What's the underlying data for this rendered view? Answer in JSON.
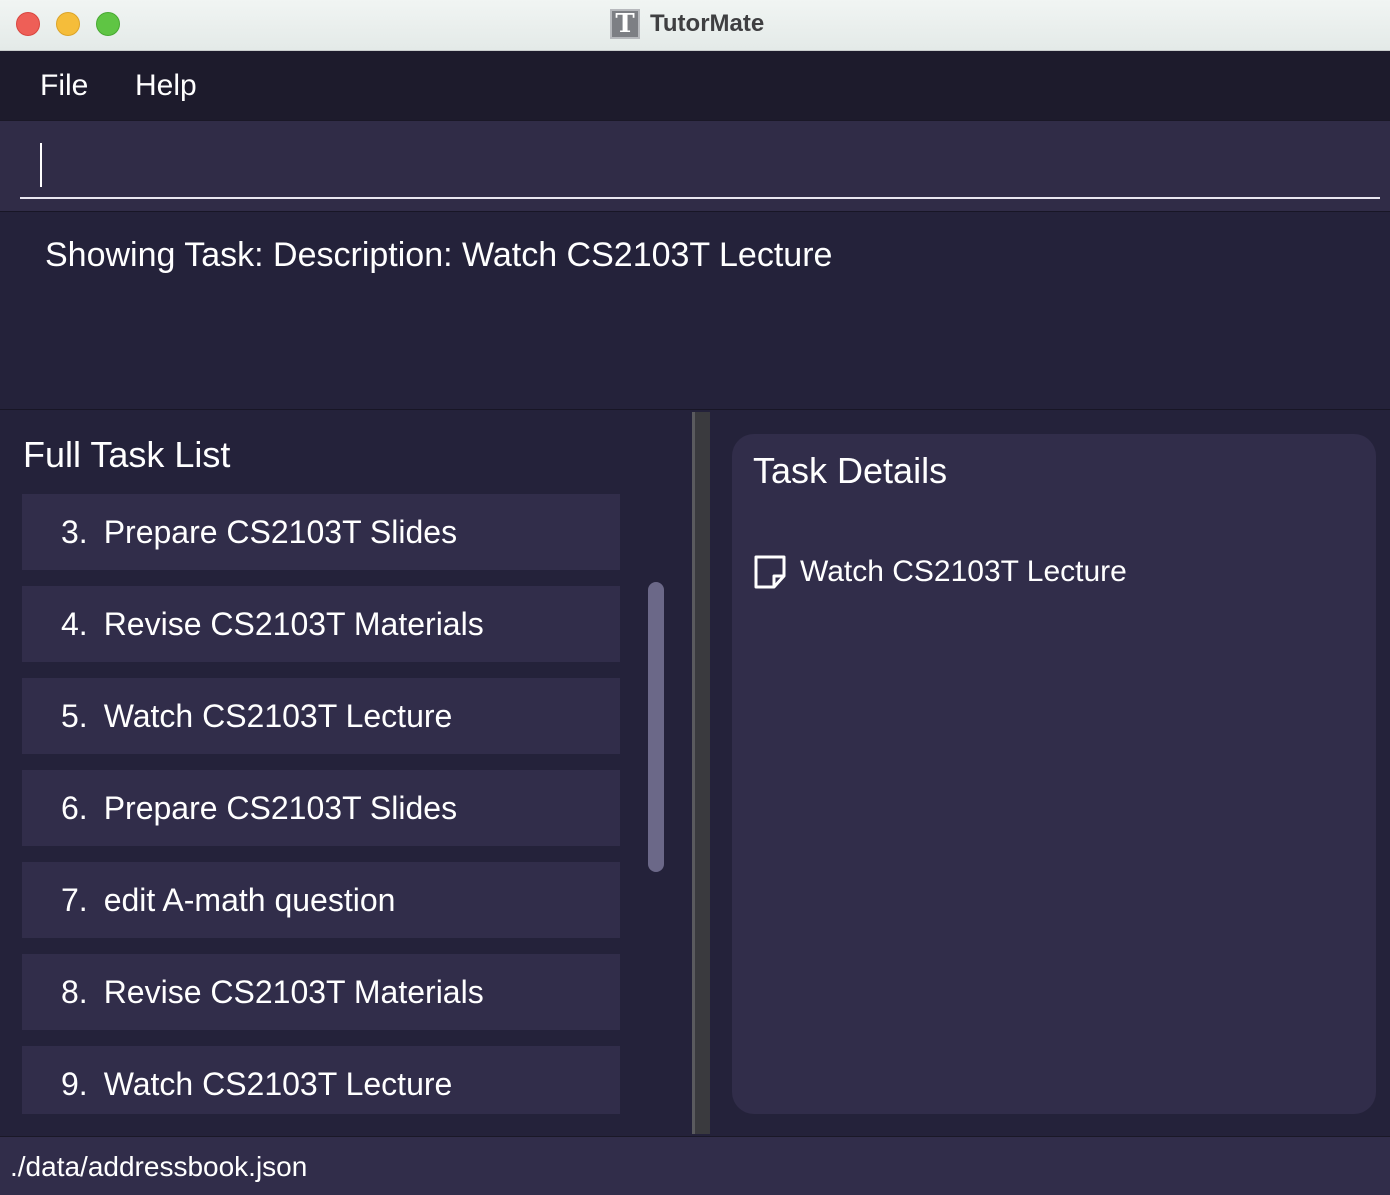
{
  "window": {
    "title": "TutorMate",
    "icon": "T"
  },
  "menu": {
    "file": "File",
    "help": "Help"
  },
  "command_box": {
    "value": "",
    "placeholder": ""
  },
  "result_display": {
    "text": "Showing Task: Description: Watch CS2103T Lecture"
  },
  "task_list": {
    "title": "Full Task List",
    "items": [
      {
        "index": "3.",
        "label": "Prepare CS2103T Slides"
      },
      {
        "index": "4.",
        "label": "Revise CS2103T Materials"
      },
      {
        "index": "5.",
        "label": "Watch CS2103T Lecture"
      },
      {
        "index": "6.",
        "label": "Prepare CS2103T Slides"
      },
      {
        "index": "7.",
        "label": "edit A-math question"
      },
      {
        "index": "8.",
        "label": "Revise CS2103T Materials"
      },
      {
        "index": "9.",
        "label": "Watch CS2103T Lecture"
      }
    ]
  },
  "task_details": {
    "title": "Task Details",
    "description": "Watch CS2103T Lecture",
    "icon": "note-icon"
  },
  "status_bar": {
    "path": "./data/addressbook.json"
  }
}
